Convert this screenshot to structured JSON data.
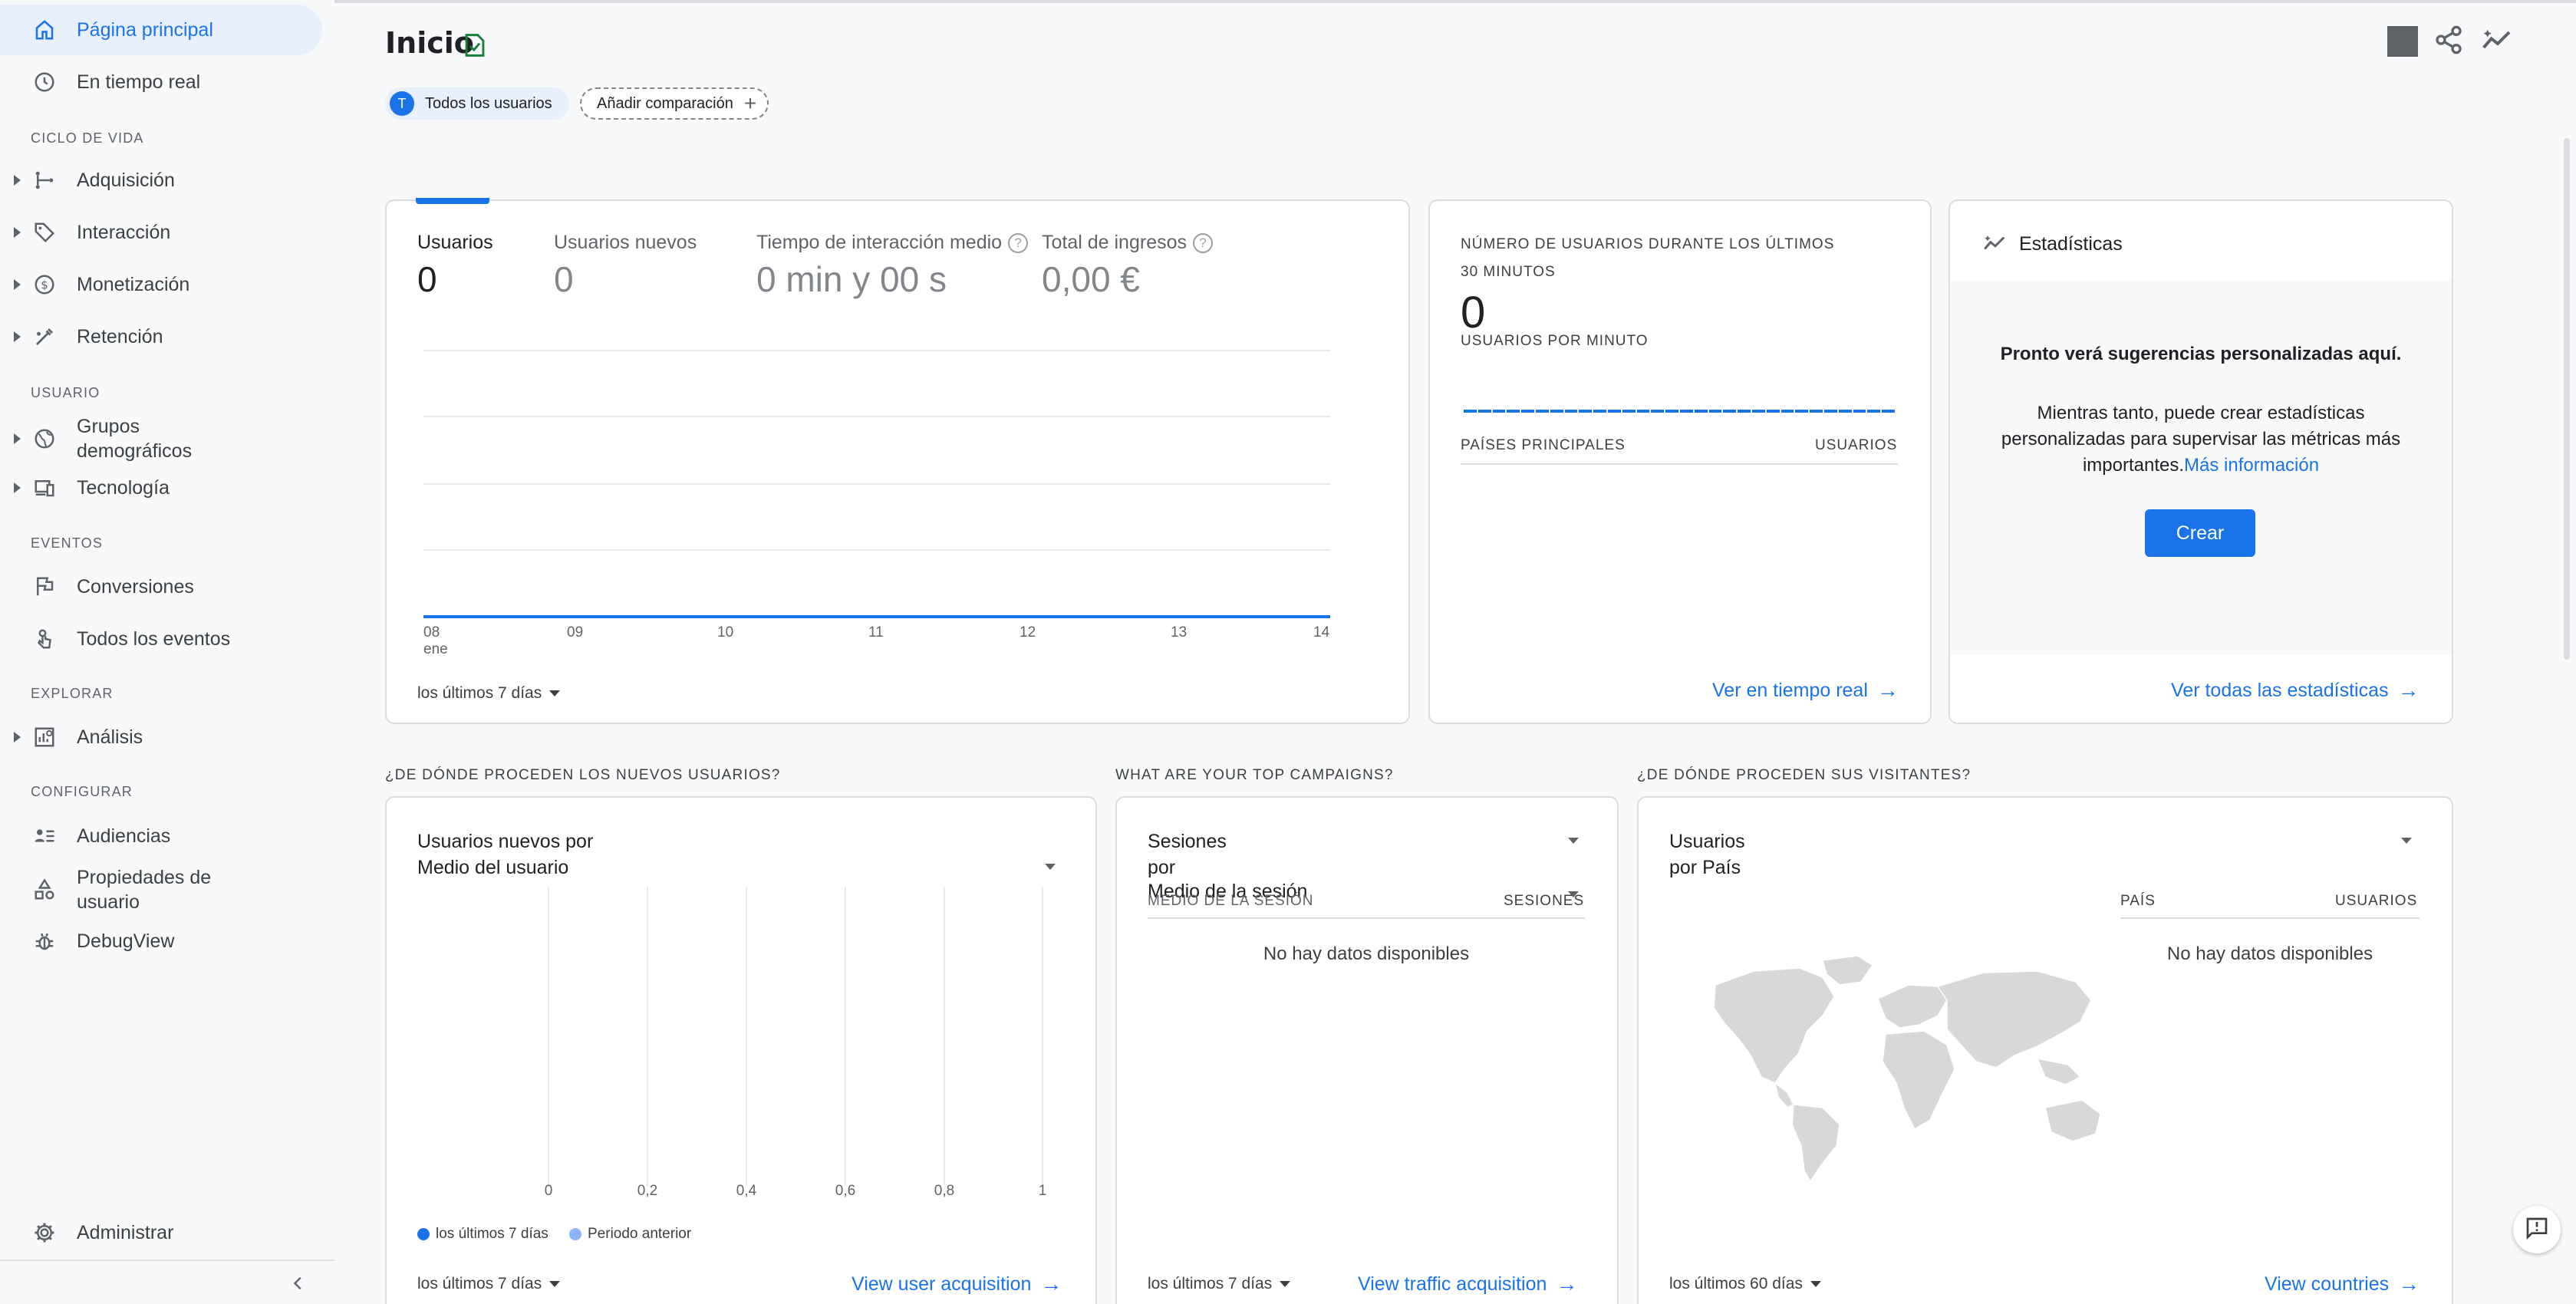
{
  "sidebar": {
    "home": "Página principal",
    "realtime": "En tiempo real",
    "sections": {
      "lifecycle": "CICLO DE VIDA",
      "user": "USUARIO",
      "events": "EVENTOS",
      "explore": "EXPLORAR",
      "configure": "CONFIGURAR"
    },
    "acquisition": "Adquisición",
    "engagement": "Interacción",
    "monetization": "Monetización",
    "retention": "Retención",
    "demographics_line1": "Grupos",
    "demographics_line2": "demográficos",
    "tech": "Tecnología",
    "conversions": "Conversiones",
    "all_events": "Todos los eventos",
    "analysis": "Análisis",
    "audiences": "Audiencias",
    "user_props_line1": "Propiedades de",
    "user_props_line2": "usuario",
    "debugview": "DebugView",
    "admin": "Administrar"
  },
  "header": {
    "title": "Inicio",
    "chip_avatar": "T",
    "chip_users": "Todos los usuarios",
    "chip_add": "Añadir comparación"
  },
  "overview": {
    "metrics": [
      {
        "label": "Usuarios",
        "value": "0"
      },
      {
        "label": "Usuarios nuevos",
        "value": "0"
      },
      {
        "label": "Tiempo de interacción medio",
        "value": "0 min y 00 s"
      },
      {
        "label": "Total de ingresos",
        "value": "0,00 €"
      }
    ],
    "x_ticks": [
      "08",
      "09",
      "10",
      "11",
      "12",
      "13",
      "14"
    ],
    "x_month": "ene",
    "range": "los últimos 7 días"
  },
  "realtime_card": {
    "title_line1": "NÚMERO DE USUARIOS DURANTE LOS ÚLTIMOS",
    "title_line2": "30 MINUTOS",
    "value": "0",
    "per_minute": "USUARIOS POR MINUTO",
    "col_countries": "PAÍSES PRINCIPALES",
    "col_users": "USUARIOS",
    "link": "Ver en tiempo real"
  },
  "insights_card": {
    "title": "Estadísticas",
    "headline": "Pronto verá sugerencias personalizadas aquí.",
    "body_line1": "Mientras tanto, puede crear estadísticas",
    "body_line2": "personalizadas para supervisar las métricas más",
    "body_line3": "importantes.",
    "more_info": "Más información",
    "create": "Crear",
    "link": "Ver todas las estadísticas"
  },
  "new_users": {
    "section": "¿DE DÓNDE PROCEDEN LOS NUEVOS USUARIOS?",
    "title_line1": "Usuarios nuevos por",
    "title_line2": "Medio del usuario",
    "ticks": [
      "0",
      "0,2",
      "0,4",
      "0,6",
      "0,8",
      "1"
    ],
    "legend_current": "los últimos 7 días",
    "legend_previous": "Periodo anterior",
    "range": "los últimos 7 días",
    "link": "View user acquisition"
  },
  "campaigns": {
    "section": "WHAT ARE YOUR TOP CAMPAIGNS?",
    "title_line1": "Sesiones",
    "title_line2": "por",
    "title_line3": "Medio de la sesión",
    "col_medium": "MEDIO DE LA SESIÓN",
    "col_sessions": "SESIONES",
    "empty": "No hay datos disponibles",
    "range": "los últimos 7 días",
    "link": "View traffic acquisition"
  },
  "visitors": {
    "section": "¿DE DÓNDE PROCEDEN SUS VISITANTES?",
    "title_line1": "Usuarios",
    "title_line2": "por País",
    "col_country": "PAÍS",
    "col_users": "USUARIOS",
    "empty": "No hay datos disponibles",
    "range": "los últimos 60 días",
    "link": "View countries"
  },
  "colors": {
    "accent": "#1a73e8",
    "legend_previous": "#8ab4f8",
    "map": "#d8d8d8"
  }
}
